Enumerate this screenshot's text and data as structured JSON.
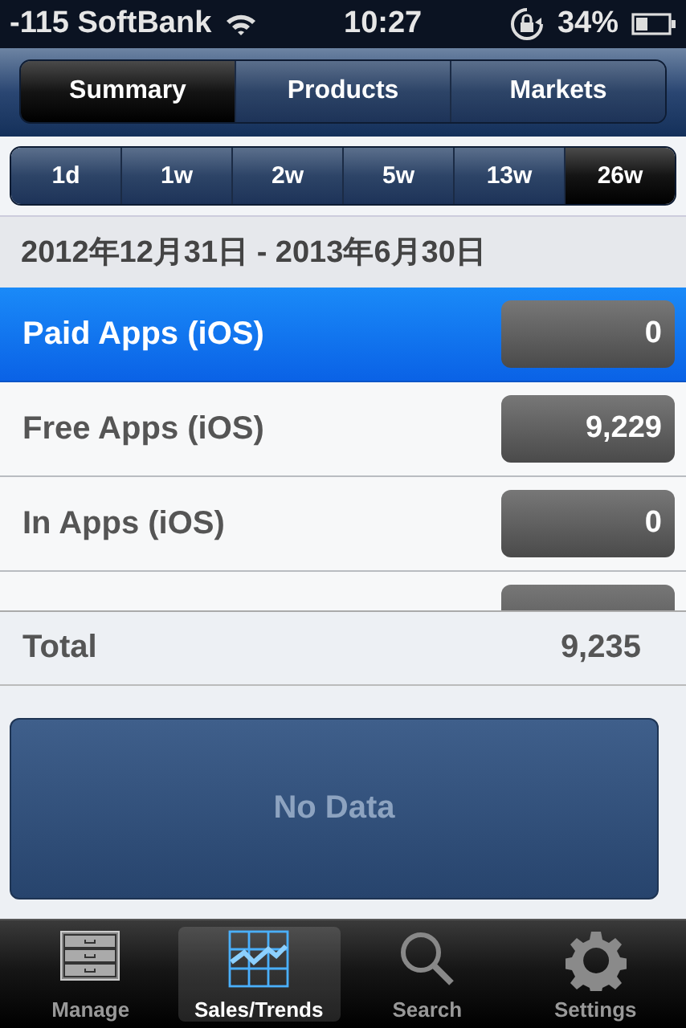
{
  "status_bar": {
    "carrier": "-115 SoftBank",
    "time": "10:27",
    "battery": "34%"
  },
  "view_tabs": [
    {
      "label": "Summary",
      "selected": true
    },
    {
      "label": "Products",
      "selected": false
    },
    {
      "label": "Markets",
      "selected": false
    }
  ],
  "periods": [
    {
      "label": "1d",
      "selected": false
    },
    {
      "label": "1w",
      "selected": false
    },
    {
      "label": "2w",
      "selected": false
    },
    {
      "label": "5w",
      "selected": false
    },
    {
      "label": "13w",
      "selected": false
    },
    {
      "label": "26w",
      "selected": true
    }
  ],
  "date_range": "2012年12月31日 - 2013年6月30日",
  "rows": [
    {
      "label": "Paid Apps (iOS)",
      "value": "0",
      "selected": true
    },
    {
      "label": "Free Apps (iOS)",
      "value": "9,229",
      "selected": false
    },
    {
      "label": "In Apps (iOS)",
      "value": "0",
      "selected": false
    }
  ],
  "total": {
    "label": "Total",
    "value": "9,235"
  },
  "chart_message": "No Data",
  "tab_bar": [
    {
      "label": "Manage",
      "kind": "drawers",
      "selected": false
    },
    {
      "label": "Sales/Trends",
      "kind": "chart",
      "selected": true
    },
    {
      "label": "Search",
      "kind": "search",
      "selected": false
    },
    {
      "label": "Settings",
      "kind": "gear",
      "selected": false
    }
  ]
}
